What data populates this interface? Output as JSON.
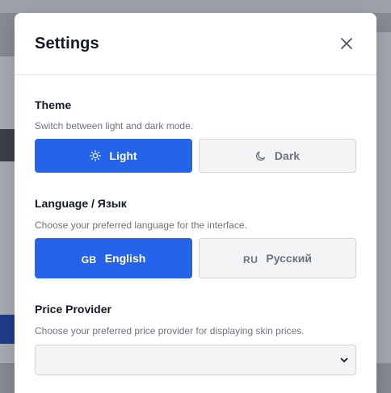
{
  "settings": {
    "title": "Settings",
    "close_icon": "close-icon",
    "theme": {
      "title": "Theme",
      "description": "Switch between light and dark mode.",
      "options": [
        {
          "label": "Light",
          "icon": "sun-icon",
          "selected": true
        },
        {
          "label": "Dark",
          "icon": "moon-icon",
          "selected": false
        }
      ]
    },
    "language": {
      "title": "Language / Язык",
      "description": "Choose your preferred language for the interface.",
      "options": [
        {
          "code": "GB",
          "label": "English",
          "selected": true
        },
        {
          "code": "RU",
          "label": "Русский",
          "selected": false
        }
      ]
    },
    "price_provider": {
      "title": "Price Provider",
      "description": "Choose your preferred price provider for displaying skin prices.",
      "selected_value": ""
    }
  },
  "colors": {
    "accent": "#2563eb",
    "inactive_bg": "#f3f4f6",
    "border": "#d1d5db"
  }
}
